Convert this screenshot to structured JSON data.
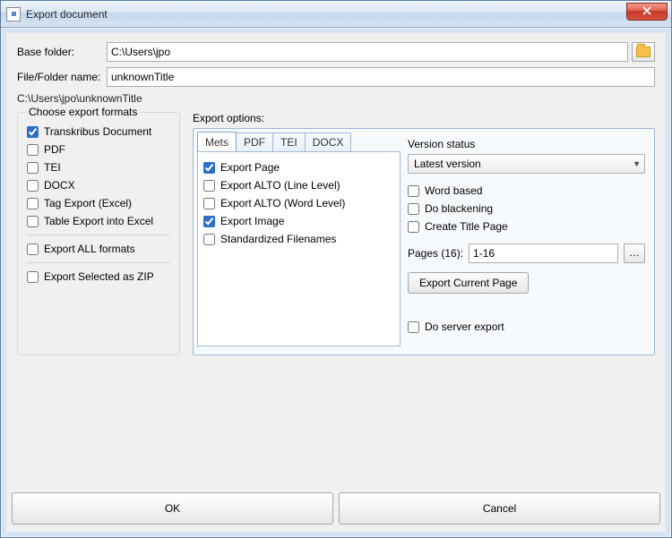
{
  "window": {
    "title": "Export document"
  },
  "form": {
    "base_folder_label": "Base folder:",
    "base_folder_value": "C:\\Users\\jpo",
    "file_folder_label": "File/Folder name:",
    "file_folder_value": "unknownTitle",
    "full_path": "C:\\Users\\jpo\\unknownTitle"
  },
  "formats": {
    "group_title": "Choose export formats",
    "items": [
      {
        "label": "Transkribus Document",
        "checked": true
      },
      {
        "label": "PDF",
        "checked": false
      },
      {
        "label": "TEI",
        "checked": false
      },
      {
        "label": "DOCX",
        "checked": false
      },
      {
        "label": "Tag Export (Excel)",
        "checked": false
      },
      {
        "label": "Table Export into Excel",
        "checked": false
      }
    ],
    "export_all_label": "Export ALL formats",
    "export_zip_label": "Export Selected as ZIP"
  },
  "options": {
    "label": "Export options:",
    "tabs": [
      {
        "label": "Mets"
      },
      {
        "label": "PDF"
      },
      {
        "label": "TEI"
      },
      {
        "label": "DOCX"
      }
    ],
    "mets_items": [
      {
        "label": "Export Page",
        "checked": true
      },
      {
        "label": "Export ALTO (Line Level)",
        "checked": false
      },
      {
        "label": "Export ALTO (Word Level)",
        "checked": false
      },
      {
        "label": "Export Image",
        "checked": true
      },
      {
        "label": "Standardized Filenames",
        "checked": false
      }
    ]
  },
  "version": {
    "label": "Version status",
    "selected": "Latest version",
    "extra": [
      {
        "label": "Word based",
        "checked": false
      },
      {
        "label": "Do blackening",
        "checked": false
      },
      {
        "label": "Create Title Page",
        "checked": false
      }
    ],
    "pages_label": "Pages (16):",
    "pages_value": "1-16",
    "export_current_label": "Export Current Page",
    "server_export_label": "Do server export"
  },
  "buttons": {
    "ok": "OK",
    "cancel": "Cancel"
  }
}
